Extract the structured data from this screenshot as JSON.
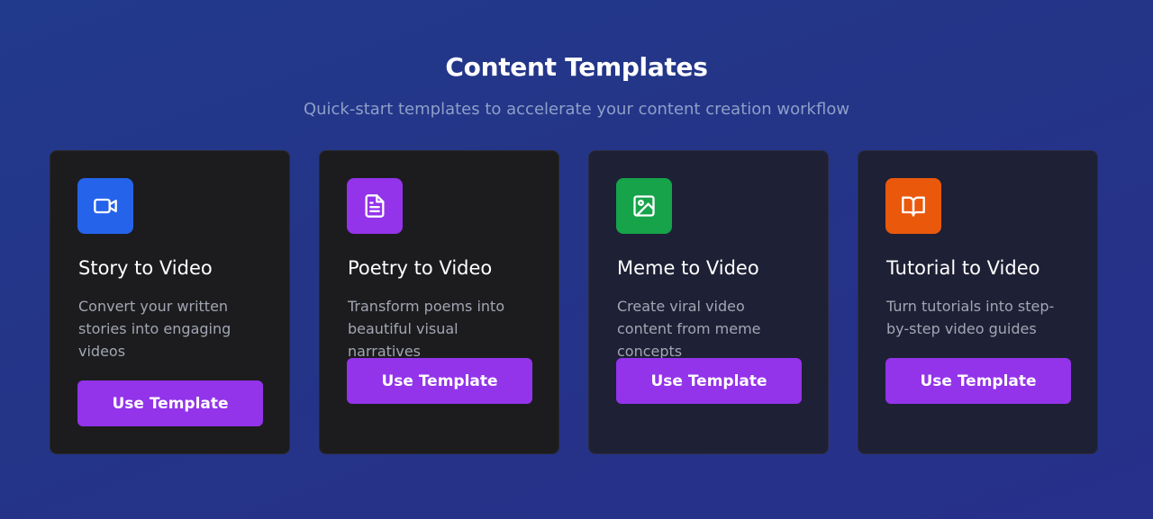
{
  "header": {
    "title": "Content Templates",
    "subtitle": "Quick-start templates to accelerate your content creation workflow"
  },
  "templates": [
    {
      "title": "Story to Video",
      "description": "Convert your written stories into engaging videos",
      "button_label": "Use Template",
      "icon": "video-camera-icon",
      "icon_color": "#2563eb"
    },
    {
      "title": "Poetry to Video",
      "description": "Transform poems into beautiful visual narratives",
      "button_label": "Use Template",
      "icon": "document-icon",
      "icon_color": "#9333ea"
    },
    {
      "title": "Meme to Video",
      "description": "Create viral video content from meme concepts",
      "button_label": "Use Template",
      "icon": "image-icon",
      "icon_color": "#16a34a"
    },
    {
      "title": "Tutorial to Video",
      "description": "Turn tutorials into step-by-step video guides",
      "button_label": "Use Template",
      "icon": "book-open-icon",
      "icon_color": "#ea580c"
    }
  ],
  "colors": {
    "accent": "#9333ea",
    "card_dark": "#1c1c1e",
    "card_navy": "#1e2035"
  }
}
